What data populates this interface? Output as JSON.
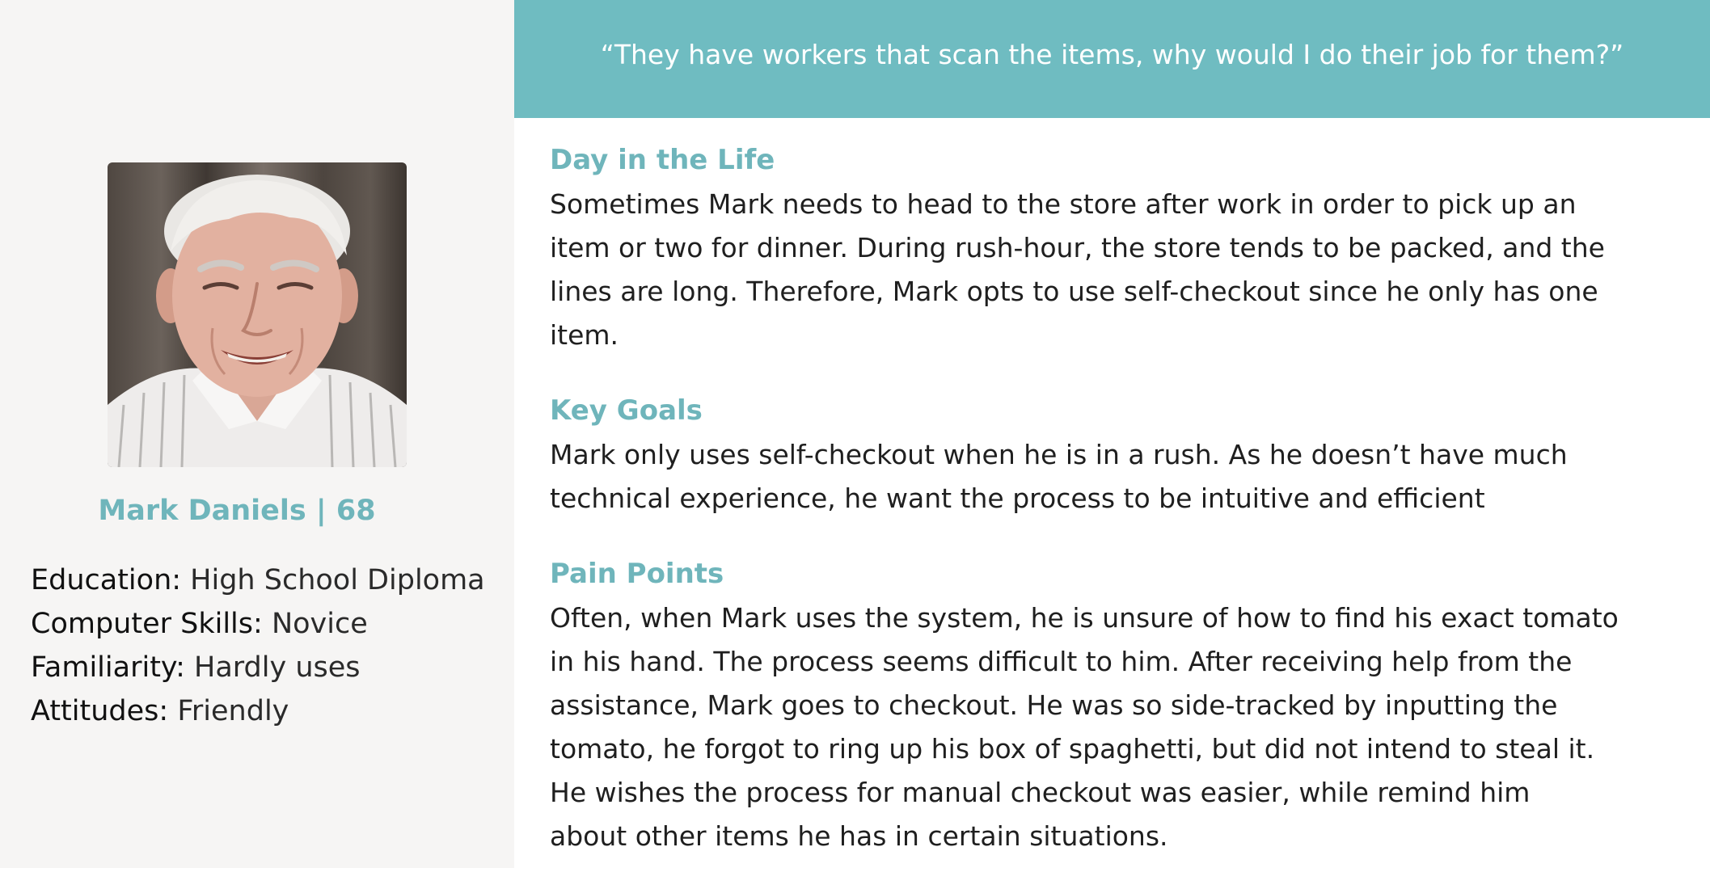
{
  "quote": "“They have workers that scan the items, why would I do their job for them?”",
  "persona": {
    "name": "Mark Daniels | 68",
    "photo_alt": "Portrait of smiling elderly man",
    "details": [
      {
        "label": "Education:",
        "value": "  High School Diploma"
      },
      {
        "label": "Computer Skills:",
        "value": " Novice"
      },
      {
        "label": "Familiarity:",
        "value": " Hardly uses"
      },
      {
        "label": "Attitudes:",
        "value": " Friendly"
      }
    ]
  },
  "sections": {
    "day_in_life": {
      "heading": "Day in the Life",
      "lines": [
        "Sometimes Mark needs to head to the store after work in order to pick up an",
        "item or two for dinner. During rush-hour, the store tends to be packed, and the",
        "lines are long. Therefore, Mark opts to use self-checkout since he only has one",
        "item."
      ]
    },
    "key_goals": {
      "heading": "Key Goals",
      "lines": [
        "Mark only uses self-checkout when he is in a rush. As he doesn’t have much",
        "technical experience, he want the process to be intuitive and efficient"
      ]
    },
    "pain_points": {
      "heading": "Pain Points",
      "lines": [
        "Often, when Mark uses the system, he is unsure of how to find his exact tomato",
        "in his hand. The process seems difficult to him. After receiving help from the",
        "assistance, Mark goes to checkout. He was so side-tracked by inputting the",
        "tomato, he forgot to ring up his box of spaghetti, but did not intend to steal it.",
        "He wishes the process for manual checkout was easier, while remind him",
        "about other items he has in certain situations."
      ]
    }
  },
  "colors": {
    "accent": "#6fb5bb",
    "quote_bar": "#6fbcc1",
    "left_panel": "#f6f5f4"
  }
}
